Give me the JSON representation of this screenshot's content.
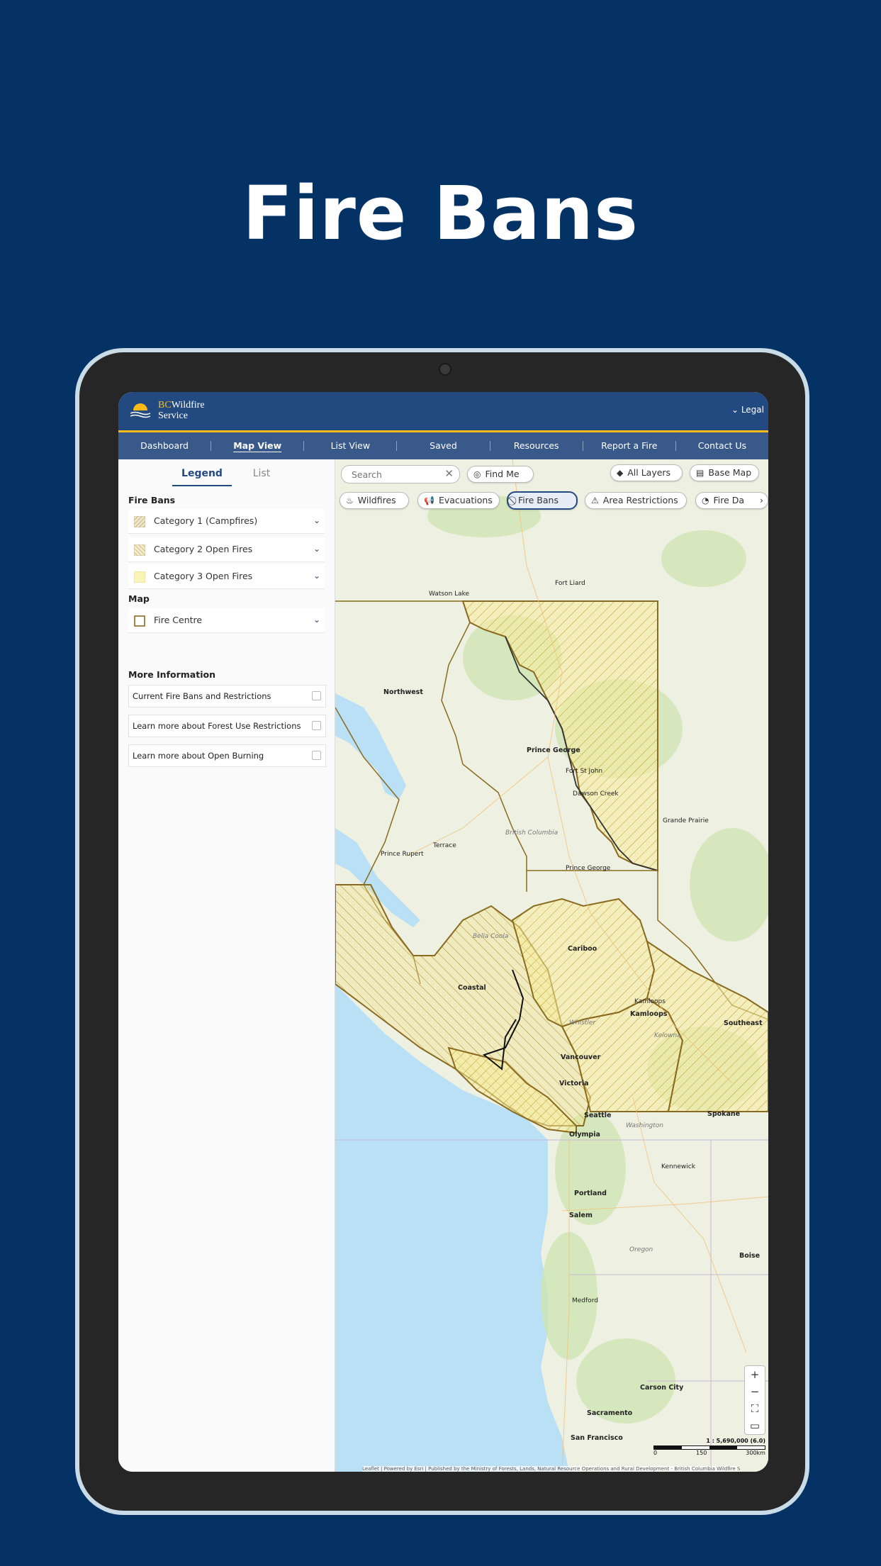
{
  "headline": "Fire Bans",
  "app": {
    "logo_text_line1_prefix": "BC",
    "logo_text_line1": "Wildfire",
    "logo_text_line2": "Service",
    "legal": "Legal"
  },
  "nav": [
    "Dashboard",
    "Map View",
    "List View",
    "Saved",
    "Resources",
    "Report a Fire",
    "Contact Us"
  ],
  "sidebar": {
    "tabs": [
      "Legend",
      "List"
    ],
    "fire_bans_title": "Fire Bans",
    "fire_bans": [
      "Category 1 (Campfires)",
      "Category 2 Open Fires",
      "Category 3 Open Fires"
    ],
    "map_title": "Map",
    "map_items": [
      "Fire Centre"
    ],
    "more_info_title": "More Information",
    "links": [
      "Current Fire Bans and Restrictions",
      "Learn more about Forest Use Restrictions",
      "Learn more about Open Burning"
    ]
  },
  "map": {
    "search_placeholder": "Search",
    "find_me": "Find Me",
    "all_layers": "All Layers",
    "base_map": "Base Map",
    "layers": [
      "Wildfires",
      "Evacuations",
      "Fire Bans",
      "Area Restrictions",
      "Fire Da"
    ],
    "labels": {
      "northwest": "Northwest",
      "prince_george": "Prince George",
      "prince_george_city": "Prince George",
      "cariboo": "Cariboo",
      "coastal": "Coastal",
      "kamloops": "Kamloops",
      "kamloops_city": "Kamloops",
      "southeast": "Southeast",
      "vancouver": "Vancouver",
      "victoria": "Victoria",
      "seattle": "Seattle",
      "olympia": "Olympia",
      "portland": "Portland",
      "salem": "Salem",
      "spokane": "Spokane",
      "kennewick": "Kennewick",
      "boise": "Boise",
      "medford": "Medford",
      "carson_city": "Carson City",
      "sacramento": "Sacramento",
      "san_francisco": "San Francisco",
      "grande_prairie": "Grande Prairie",
      "fort_st_john": "Fort St John",
      "dawson_creek": "Dawson Creek",
      "terrace": "Terrace",
      "prince_rupert": "Prince Rupert",
      "bella_coola": "Bella Coola",
      "kelowna": "Kelowna",
      "whistler": "Whistler",
      "watson_lake": "Watson Lake",
      "fort_liard": "Fort Liard",
      "british_columbia": "British Columbia",
      "washington": "Washington",
      "oregon": "Oregon"
    },
    "scale_text": "1 : 5,690,000 (6.0)",
    "scale_ticks": [
      "0",
      "150",
      "300km"
    ],
    "attribution": "Leaflet | Powered by Esri | Published by the Ministry of Forests, Lands, Natural Resource Operations and Rural Development - British Columbia Wildfire S"
  },
  "colors": {
    "background": "#053264",
    "appbar": "#234a80",
    "nav": "#38598a",
    "accent": "#fcba19",
    "ban_fill": "#f6e58a",
    "ban_border": "#8a6a1f"
  },
  "icons": {
    "find_me": "target-icon",
    "all_layers": "layers-icon",
    "base_map": "map-icon",
    "wildfires": "flame-icon",
    "evacuations": "megaphone-icon",
    "fire_bans": "ban-icon",
    "area_restrictions": "warning-icon",
    "fire_danger": "gauge-icon"
  }
}
